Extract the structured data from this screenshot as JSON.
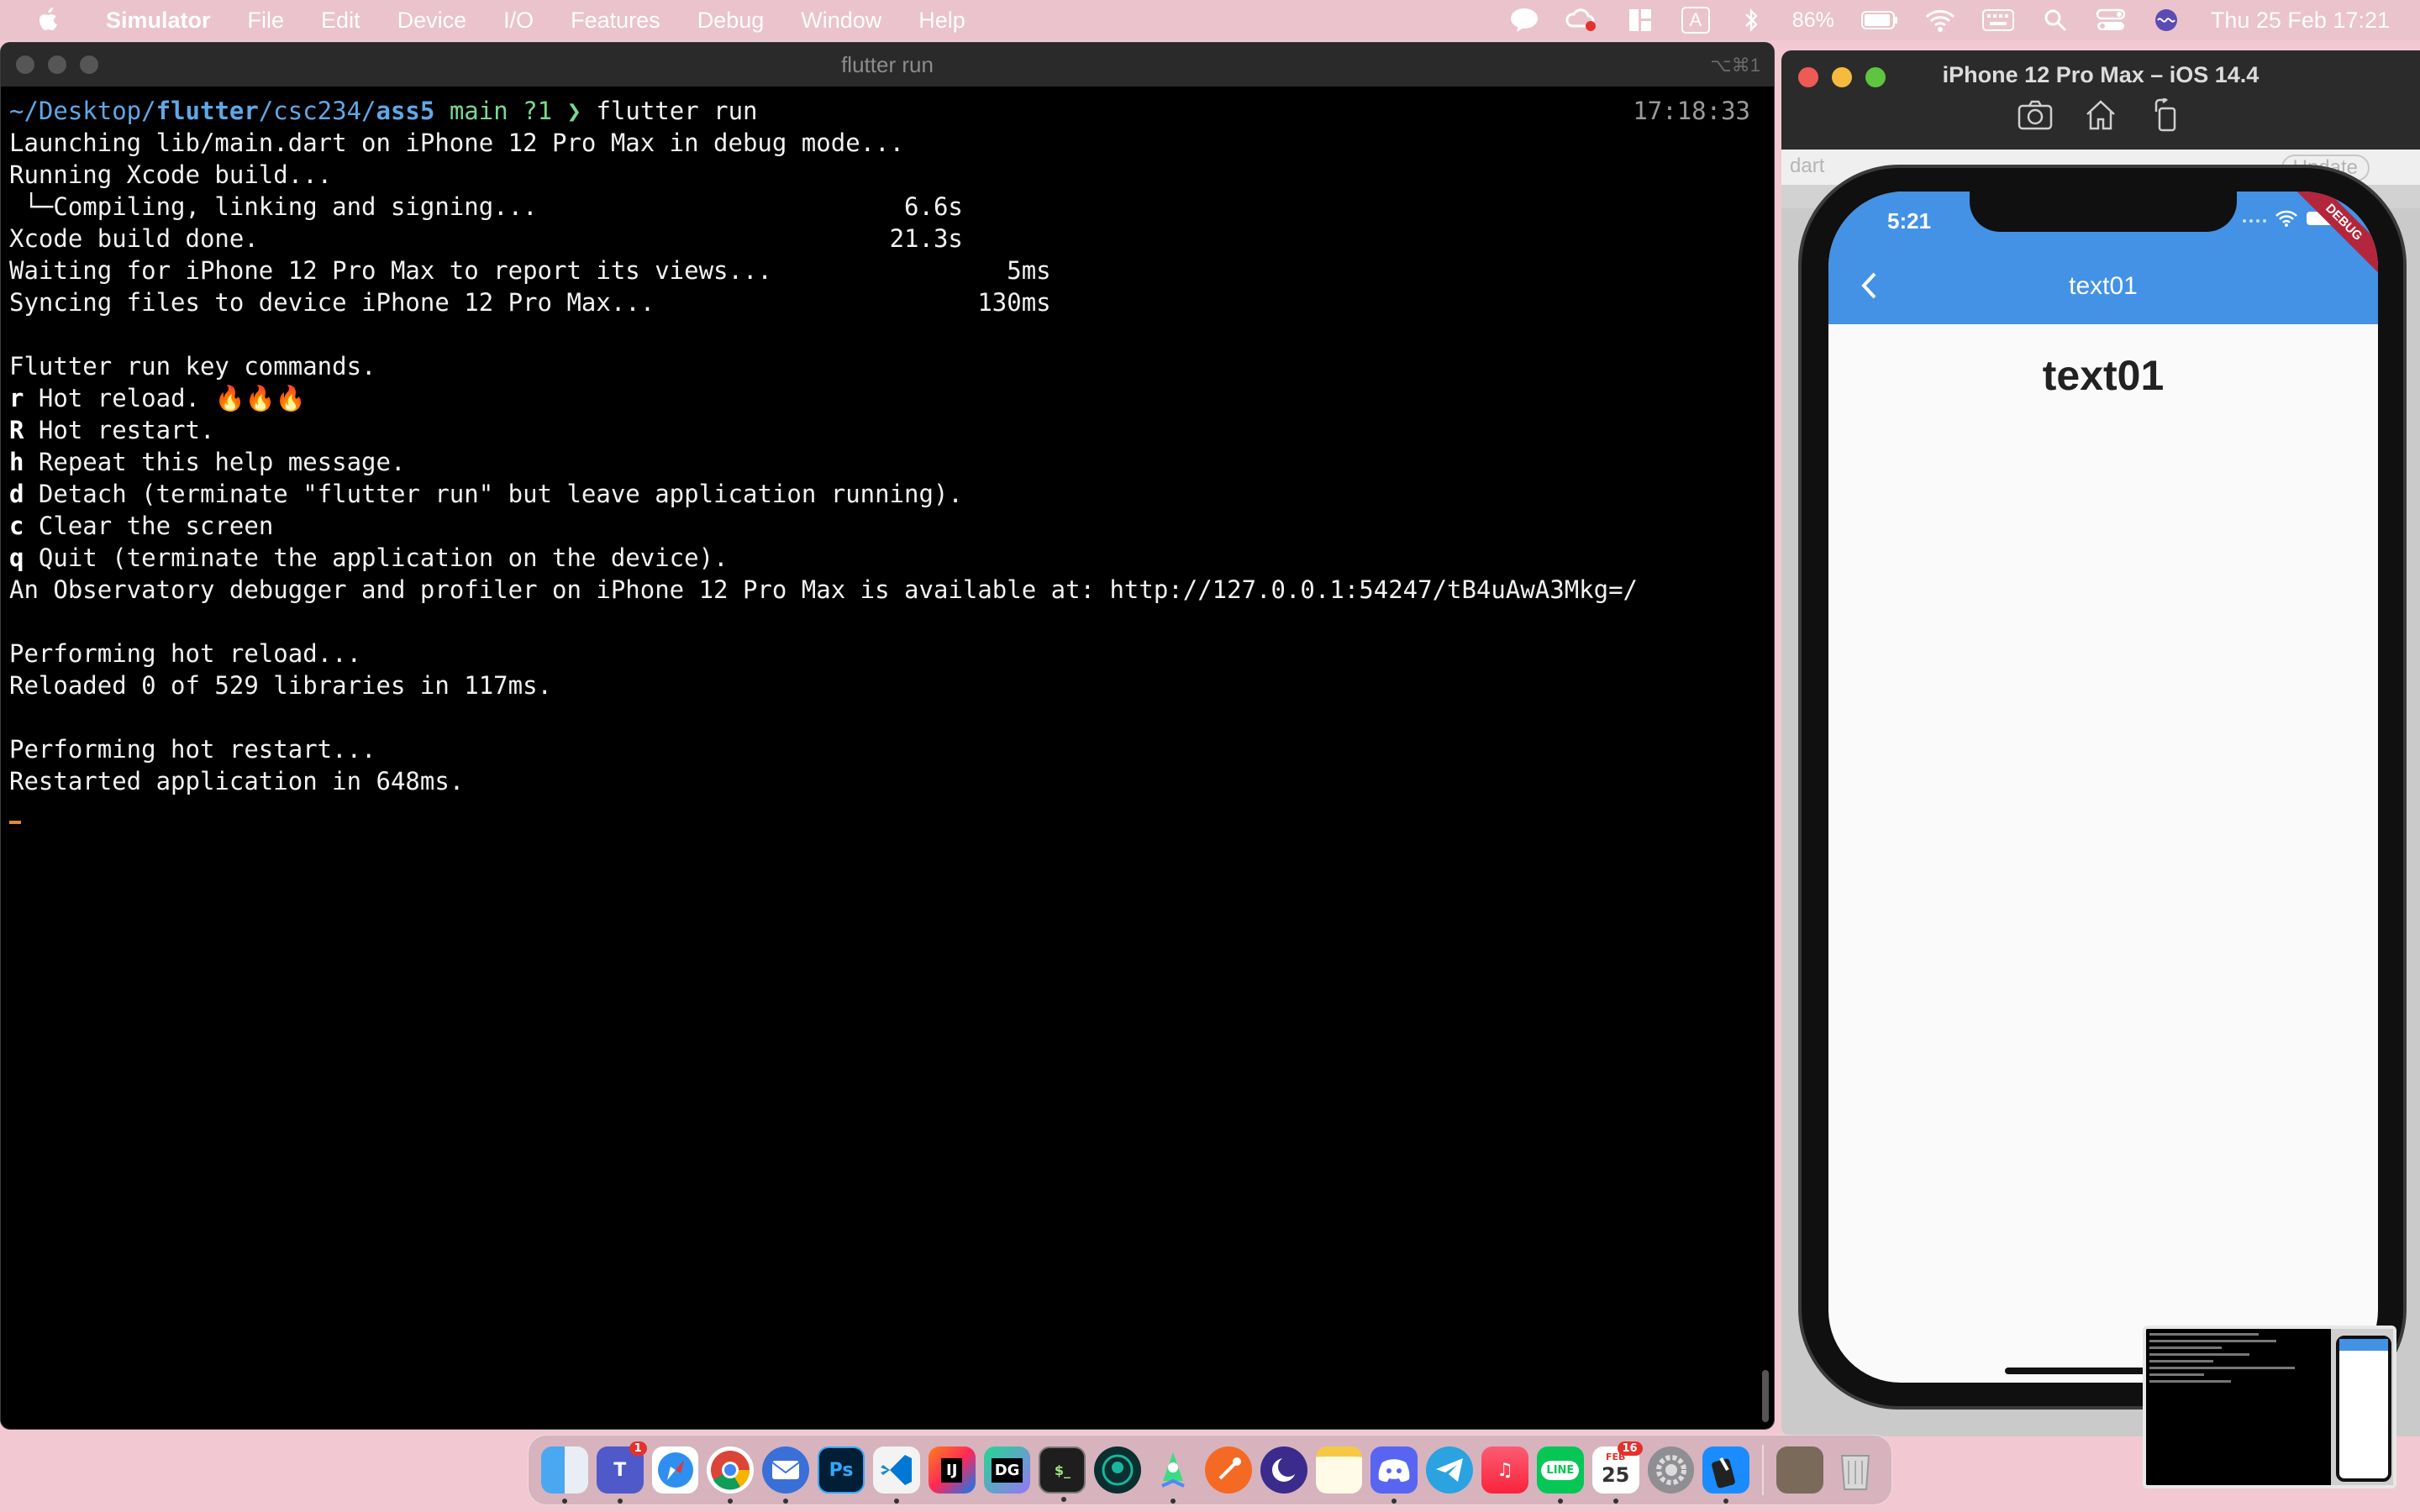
{
  "menubar": {
    "app_name": "Simulator",
    "items": [
      "File",
      "Edit",
      "Device",
      "I/O",
      "Features",
      "Debug",
      "Window",
      "Help"
    ],
    "battery": "86%",
    "input_source": "A",
    "clock": "Thu 25 Feb  17:21"
  },
  "terminal": {
    "title": "flutter run",
    "shortcut": "⌥⌘1",
    "timestamp": "17:18:33",
    "prompt": {
      "path_prefix": "~/Desktop/",
      "path_flutter": "flutter",
      "path_mid": "/csc234/",
      "path_dir": "ass5",
      "git": " main ?1",
      "arrow": " ❯ ",
      "command": "flutter run"
    },
    "lines": [
      "Launching lib/main.dart on iPhone 12 Pro Max in debug mode...",
      "Running Xcode build...",
      " └─Compiling, linking and signing...                         6.6s",
      "Xcode build done.                                           21.3s",
      "Waiting for iPhone 12 Pro Max to report its views...                5ms",
      "Syncing files to device iPhone 12 Pro Max...                      130ms",
      "",
      "Flutter run key commands."
    ],
    "key_commands": [
      {
        "key": "r",
        "text": " Hot reload. 🔥🔥🔥"
      },
      {
        "key": "R",
        "text": " Hot restart."
      },
      {
        "key": "h",
        "text": " Repeat this help message."
      },
      {
        "key": "d",
        "text": " Detach (terminate \"flutter run\" but leave application running)."
      },
      {
        "key": "c",
        "text": " Clear the screen"
      },
      {
        "key": "q",
        "text": " Quit (terminate the application on the device)."
      }
    ],
    "tail_lines": [
      "An Observatory debugger and profiler on iPhone 12 Pro Max is available at: http://127.0.0.1:54247/tB4uAwA3Mkg=/",
      "",
      "Performing hot reload...",
      "Reloaded 0 of 529 libraries in 117ms.",
      "",
      "Performing hot restart...",
      "Restarted application in 648ms."
    ]
  },
  "simulator": {
    "title": "iPhone 12 Pro Max – iOS 14.4",
    "backdrop_text": "dart",
    "backdrop_button": "Update",
    "phone": {
      "time": "5:21",
      "debug_banner": "DEBUG",
      "appbar_title": "text01",
      "body_text": "text01"
    }
  },
  "dock": {
    "teams_badge": "1",
    "calendar_month": "FEB",
    "calendar_day": "25",
    "calendar_badge": "16"
  },
  "colors": {
    "desktop": "#f2c9d3",
    "appbar": "#4392e5",
    "debug_banner": "#b3263c"
  }
}
